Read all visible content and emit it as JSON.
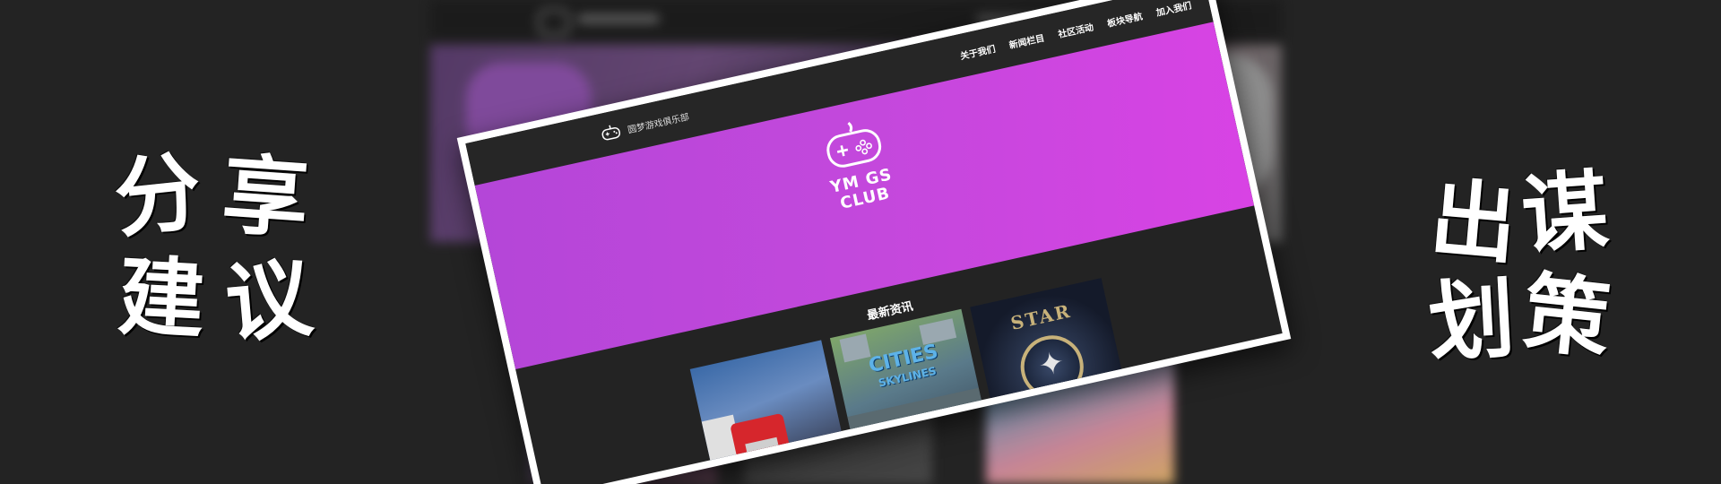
{
  "left_caption": {
    "chars": [
      "分",
      "享",
      "建",
      "议"
    ]
  },
  "right_caption": {
    "chars": [
      "出",
      "谋",
      "划",
      "策"
    ]
  },
  "site": {
    "name": "圆梦游戏俱乐部",
    "nav": [
      "关于我们",
      "新闻栏目",
      "社区活动",
      "板块导航",
      "加入我们"
    ],
    "hero_logo_lines": [
      "YM GS",
      "CLUB"
    ],
    "section_title": "最新资讯",
    "news_cards": [
      {
        "image": "american-truck-simulator"
      },
      {
        "image": "cities-skylines",
        "title": "CITIES",
        "subtitle": "SKYLINES"
      },
      {
        "image": "star-citizen",
        "title": "STAR"
      }
    ]
  },
  "colors": {
    "hero_purple": "#c348dc",
    "dark_bg": "#232323",
    "frame_white": "#ffffff"
  }
}
